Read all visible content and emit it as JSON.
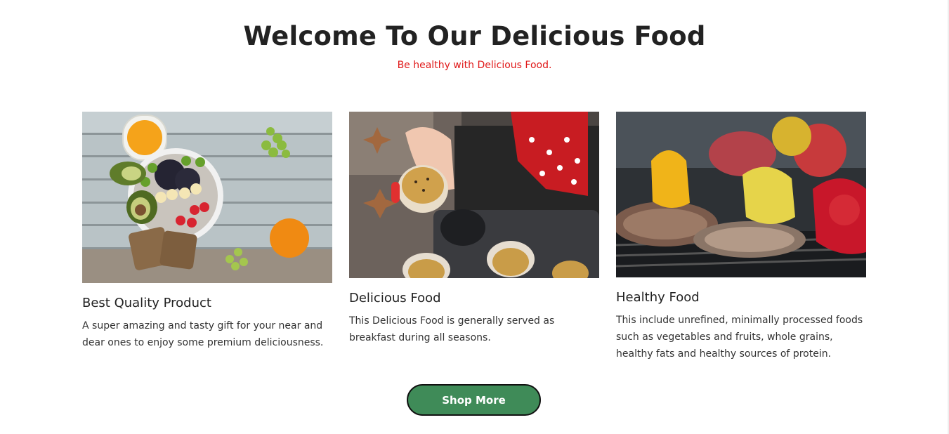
{
  "header": {
    "title": "Welcome To Our Delicious Food",
    "subtitle": "Be healthy with Delicious Food."
  },
  "cards": [
    {
      "title": "Best Quality Product",
      "text": "A super amazing and tasty gift for your near and dear ones to enjoy some premium deliciousness.",
      "image_subject": "breakfast-bowl-on-wooden-table"
    },
    {
      "title": "Delicious Food",
      "text": "This Delicious Food is generally served as breakfast during all seasons.",
      "image_subject": "hand-holding-muffin-over-baking-tray"
    },
    {
      "title": "Healthy Food",
      "text": "This include unrefined, minimally processed foods such as vegetables and fruits, whole grains, healthy fats and healthy sources of protein.",
      "image_subject": "grilled-meat-and-peppers"
    }
  ],
  "cta": {
    "label": "Shop More"
  },
  "colors": {
    "subtitle": "#e01818",
    "button": "#3f8b58",
    "heading": "#222222"
  }
}
